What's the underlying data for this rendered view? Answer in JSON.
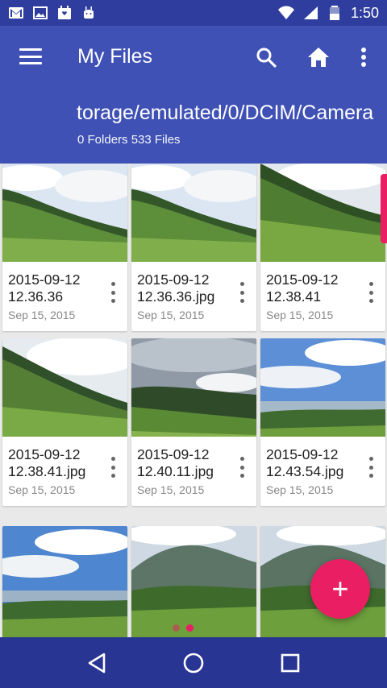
{
  "status_bar": {
    "time": "1:50",
    "icons": [
      "gmail-icon",
      "gallery-icon",
      "calendar-icon",
      "android-icon",
      "wifi-icon",
      "signal-icon",
      "battery-icon"
    ]
  },
  "app_bar": {
    "title": "My Files",
    "path": "torage/emulated/0/DCIM/Camera",
    "counts": "0 Folders 533 Files",
    "actions": [
      "menu-icon",
      "search-icon",
      "home-icon",
      "more-vert-icon"
    ]
  },
  "files": [
    {
      "name": "2015-09-12 12.36.36",
      "date": "Sep 15, 2015",
      "scene": "hill-cloudy"
    },
    {
      "name": "2015-09-12 12.36.36.jpg",
      "date": "Sep 15, 2015",
      "scene": "hill-cloudy"
    },
    {
      "name": "2015-09-12 12.38.41",
      "date": "Sep 15, 2015",
      "scene": "hill-trees"
    },
    {
      "name": "2015-09-12 12.38.41.jpg",
      "date": "Sep 15, 2015",
      "scene": "hill-trees"
    },
    {
      "name": "2015-09-12 12.40.11.jpg",
      "date": "Sep 15, 2015",
      "scene": "valley-dark"
    },
    {
      "name": "2015-09-12 12.43.54.jpg",
      "date": "Sep 15, 2015",
      "scene": "valley-blue"
    },
    {
      "name": "",
      "date": "",
      "scene": "valley-blue"
    },
    {
      "name": "",
      "date": "",
      "scene": "mountain"
    },
    {
      "name": "",
      "date": "",
      "scene": "mountain"
    }
  ],
  "fab": {
    "label": "+"
  },
  "colors": {
    "primary": "#3f51b5",
    "primary_dark": "#2f3e9e",
    "accent": "#e91e63",
    "nav": "#283593"
  }
}
